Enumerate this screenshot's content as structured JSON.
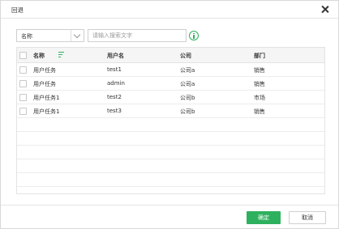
{
  "dialog": {
    "title": "回退"
  },
  "filter": {
    "select_value": "名称",
    "search_placeholder": "请输入搜索文字",
    "search_value": ""
  },
  "table": {
    "columns": [
      "名称",
      "用户名",
      "公司",
      "部门"
    ],
    "rows": [
      [
        "用户任务",
        "test1",
        "公司a",
        "销售"
      ],
      [
        "用户任务",
        "admin",
        "公司a",
        "销售"
      ],
      [
        "用户任务1",
        "test2",
        "公司b",
        "市场"
      ],
      [
        "用户任务1",
        "test3",
        "公司b",
        "销售"
      ]
    ]
  },
  "footer": {
    "ok_label": "确定",
    "cancel_label": "取消"
  },
  "colors": {
    "accent": "#2eb15e",
    "header_bg": "#f5f5f5",
    "border": "#e3e3e3"
  },
  "icons": {
    "close": "close-icon",
    "info": "info-icon",
    "sort": "sort-filter-icon",
    "dropdown": "chevron-down-icon"
  }
}
